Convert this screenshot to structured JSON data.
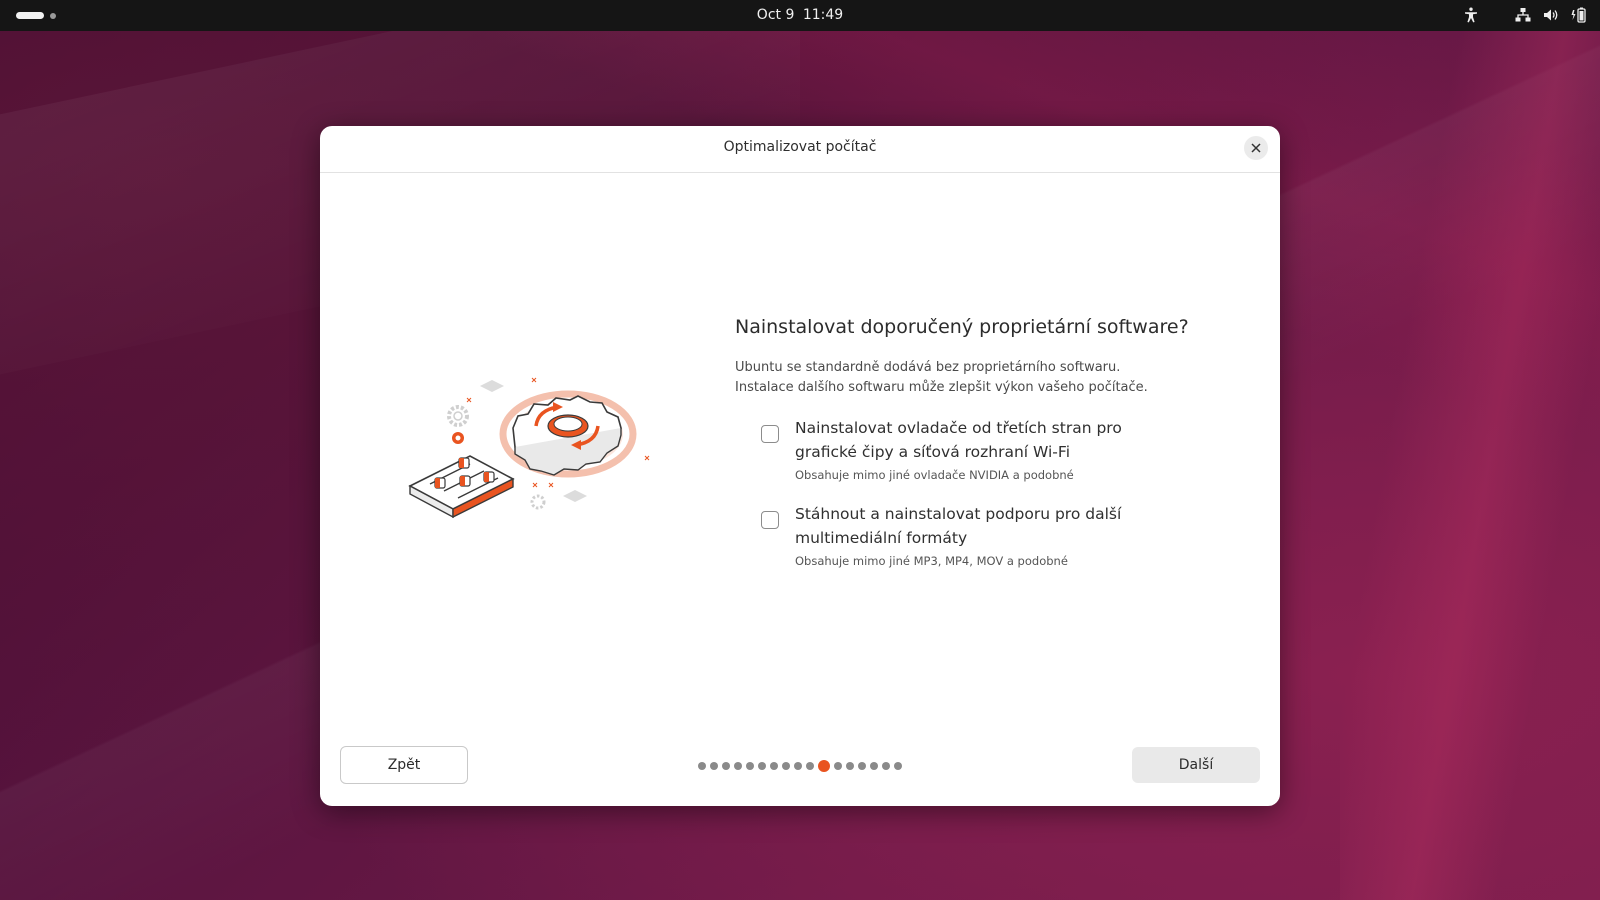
{
  "topbar": {
    "date": "Oct 9",
    "time": "11:49",
    "icons": [
      "accessibility-icon",
      "network-icon",
      "volume-icon",
      "battery-icon"
    ]
  },
  "dialog": {
    "title": "Optimalizovat počítač",
    "heading": "Nainstalovat doporučený proprietární software?",
    "description_line1": "Ubuntu se standardně dodává bez proprietárního softwaru.",
    "description_line2": "Instalace dalšího softwaru může zlepšit výkon vašeho počítače.",
    "options": [
      {
        "label": "Nainstalovat ovladače od třetích stran pro grafické čipy a síťová rozhraní Wi-Fi",
        "sublabel": "Obsahuje mimo jiné ovladače NVIDIA a podobné",
        "checked": false
      },
      {
        "label": "Stáhnout a nainstalovat podporu pro další multimediální formáty",
        "sublabel": "Obsahuje mimo jiné MP3, MP4, MOV a podobné",
        "checked": false
      }
    ],
    "back_label": "Zpět",
    "next_label": "Další",
    "pager": {
      "total": 17,
      "current": 11
    }
  },
  "colors": {
    "accent": "#e95420",
    "topbar": "#151515",
    "dialog_bg": "#ffffff"
  }
}
